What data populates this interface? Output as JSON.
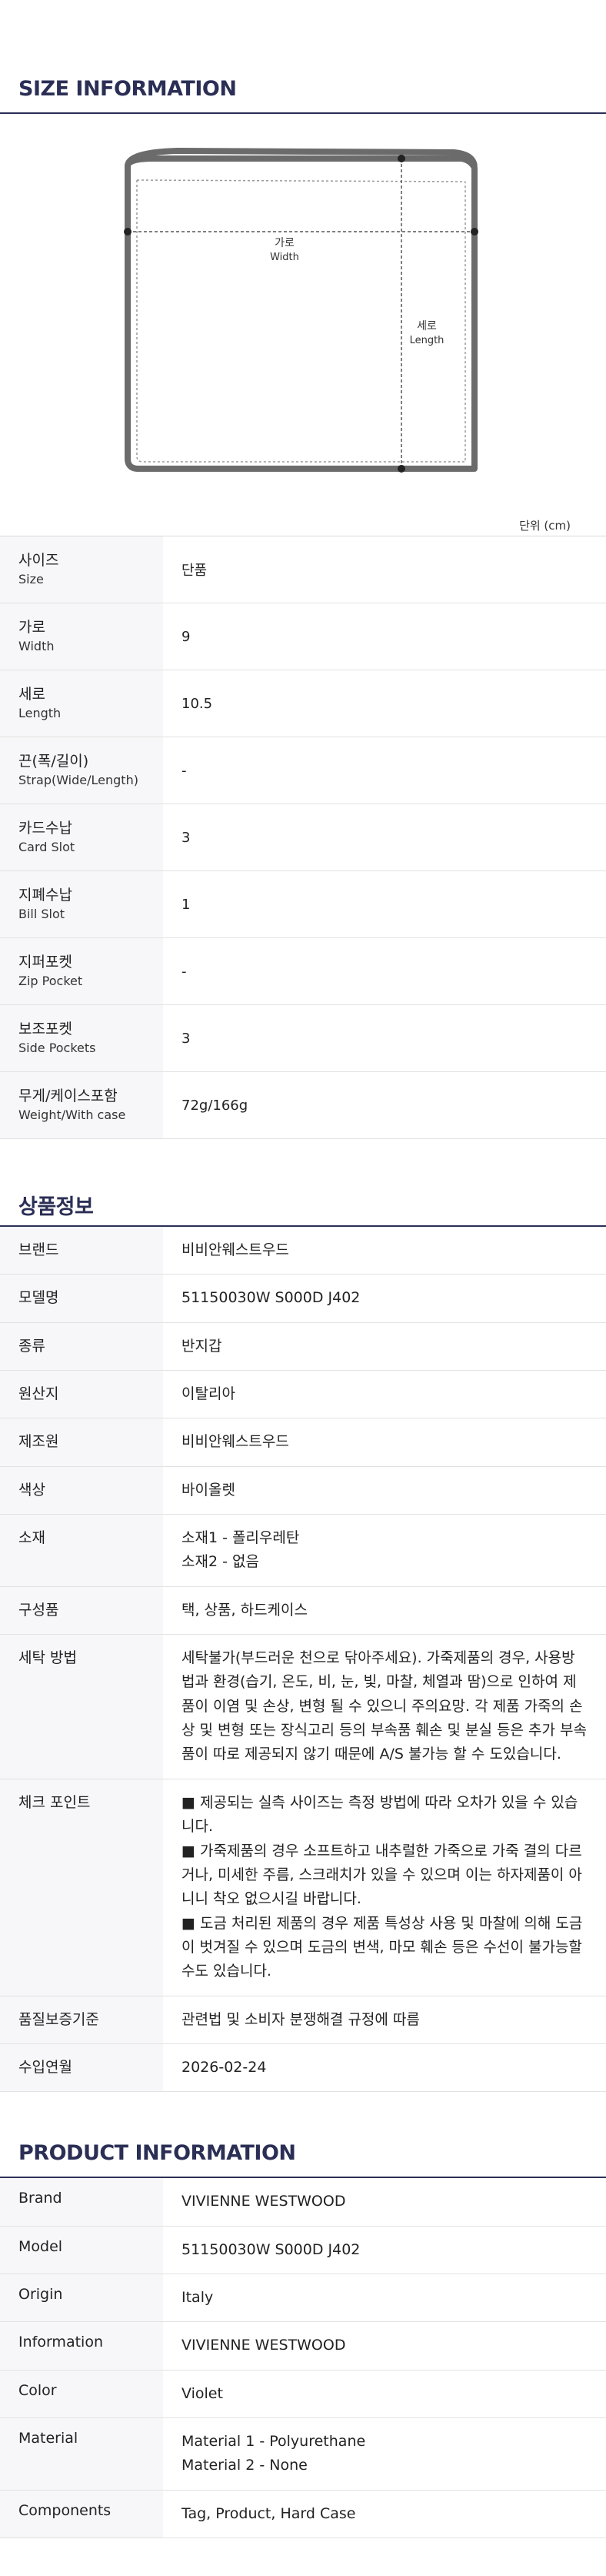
{
  "size_info": {
    "title": "SIZE INFORMATION",
    "diagram": {
      "width_ko": "가로",
      "width_en": "Width",
      "length_ko": "세로",
      "length_en": "Length"
    },
    "unit_note": "단위 (cm)",
    "rows": [
      {
        "ko": "사이즈",
        "en": "Size",
        "value": "단품"
      },
      {
        "ko": "가로",
        "en": "Width",
        "value": "9"
      },
      {
        "ko": "세로",
        "en": "Length",
        "value": "10.5"
      },
      {
        "ko": "끈(폭/길이)",
        "en": "Strap(Wide/Length)",
        "value": "-"
      },
      {
        "ko": "카드수납",
        "en": "Card Slot",
        "value": "3"
      },
      {
        "ko": "지폐수납",
        "en": "Bill Slot",
        "value": "1"
      },
      {
        "ko": "지퍼포켓",
        "en": "Zip Pocket",
        "value": "-"
      },
      {
        "ko": "보조포켓",
        "en": "Side Pockets",
        "value": "3"
      },
      {
        "ko": "무게/케이스포함",
        "en": "Weight/With case",
        "value": "72g/166g"
      }
    ]
  },
  "product_ko": {
    "title": "상품정보",
    "rows": [
      {
        "label": "브랜드",
        "lines": [
          "비비안웨스트우드"
        ]
      },
      {
        "label": "모델명",
        "lines": [
          "51150030W S000D J402"
        ]
      },
      {
        "label": "종류",
        "lines": [
          "반지갑"
        ]
      },
      {
        "label": "원산지",
        "lines": [
          "이탈리아"
        ]
      },
      {
        "label": "제조원",
        "lines": [
          "비비안웨스트우드"
        ]
      },
      {
        "label": "색상",
        "lines": [
          "바이올렛"
        ]
      },
      {
        "label": "소재",
        "lines": [
          "소재1 - 폴리우레탄",
          "소재2 - 없음"
        ]
      },
      {
        "label": "구성품",
        "lines": [
          "택, 상품, 하드케이스"
        ]
      },
      {
        "label": "세탁 방법",
        "lines": [
          "세탁불가(부드러운 천으로 닦아주세요). 가죽제품의 경우, 사용방법과 환경(습기, 온도, 비, 눈, 빛, 마찰, 체열과 땀)으로 인하여 제품이 이염 및 손상, 변형 될 수 있으니 주의요망. 각 제품 가죽의 손상 및 변형 또는 장식고리 등의 부속품 훼손 및 분실 등은 추가 부속품이 따로 제공되지 않기 때문에 A/S 불가능 할 수 도있습니다."
        ]
      },
      {
        "label": "체크 포인트",
        "lines": [
          "■ 제공되는 실측 사이즈는 측정 방법에 따라 오차가 있을 수 있습니다.",
          "■ 가죽제품의 경우 소프트하고 내추럴한 가죽으로 가죽 결의 다르거나, 미세한 주름, 스크래치가 있을 수 있으며 이는 하자제품이 아니니 착오 없으시길 바랍니다.",
          "■ 도금 처리된 제품의 경우 제품 특성상 사용 및 마찰에 의해 도금이 벗겨질 수 있으며 도금의 변색, 마모 훼손 등은 수선이 불가능할 수도 있습니다."
        ]
      },
      {
        "label": "품질보증기준",
        "lines": [
          "관련법 및 소비자 분쟁해결 규정에 따름"
        ]
      },
      {
        "label": "수입연월",
        "lines": [
          "2026-02-24"
        ]
      }
    ]
  },
  "product_en": {
    "title": "PRODUCT INFORMATION",
    "rows": [
      {
        "label": "Brand",
        "lines": [
          "VIVIENNE WESTWOOD"
        ]
      },
      {
        "label": "Model",
        "lines": [
          "51150030W S000D J402"
        ]
      },
      {
        "label": "Origin",
        "lines": [
          "Italy"
        ]
      },
      {
        "label": "Information",
        "lines": [
          "VIVIENNE WESTWOOD"
        ]
      },
      {
        "label": "Color",
        "lines": [
          "Violet"
        ]
      },
      {
        "label": "Material",
        "lines": [
          "Material 1 - Polyurethane",
          "Material 2 - None"
        ]
      },
      {
        "label": "Components",
        "lines": [
          "Tag, Product, Hard Case"
        ]
      }
    ]
  }
}
